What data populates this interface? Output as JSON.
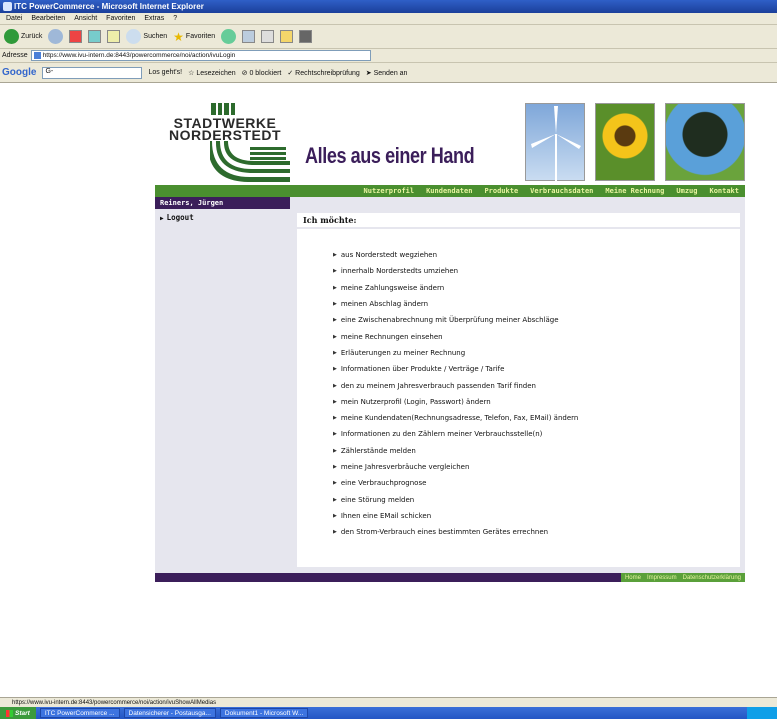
{
  "window": {
    "title": "ITC PowerCommerce - Microsoft Internet Explorer"
  },
  "menu": [
    "Datei",
    "Bearbeiten",
    "Ansicht",
    "Favoriten",
    "Extras",
    "?"
  ],
  "toolbar": {
    "back_label": "Zurück",
    "search_label": "Suchen",
    "favorites_label": "Favoriten"
  },
  "addressbar": {
    "label": "Adresse",
    "url": "https://www.ivu-intern.de:8443/powercommerce/noi/action/ivuLogin"
  },
  "googlebar": {
    "logo": "Google",
    "field": "G-",
    "go_label": "Los geht's!",
    "bookmarks_label": "Lesezeichen",
    "blocked_label": "0 blockiert",
    "spellcheck_label": "Rechtschreibprüfung",
    "send_label": "Senden an"
  },
  "page": {
    "logo_line1": "STADTWERKE",
    "logo_line2": "NORDERSTEDT",
    "slogan": "Alles aus einer Hand",
    "nav": [
      "Nutzerprofil",
      "Kundendaten",
      "Produkte",
      "Verbrauchsdaten",
      "Meine Rechnung",
      "Umzug",
      "Kontakt"
    ],
    "user_name": "Reiners, Jürgen",
    "logout_label": "Logout",
    "main_title": "Ich möchte:",
    "options": [
      "aus Norderstedt wegziehen",
      "innerhalb Norderstedts umziehen",
      "meine Zahlungsweise ändern",
      "meinen Abschlag ändern",
      "eine Zwischenabrechnung mit Überprüfung meiner Abschläge",
      "meine Rechnungen einsehen",
      "Erläuterungen zu meiner Rechnung",
      "Informationen über Produkte / Verträge / Tarife",
      "den zu meinem Jahresverbrauch passenden Tarif finden",
      "mein Nutzerprofil (Login, Passwort) ändern",
      "meine Kundendaten(Rechnungsadresse, Telefon, Fax, EMail) ändern",
      "Informationen zu den Zählern meiner Verbrauchsstelle(n)",
      "Zählerstände melden",
      "meine Jahresverbräuche vergleichen",
      "eine Verbrauchprognose",
      "eine Störung melden",
      "Ihnen eine EMail schicken",
      "den Strom-Verbrauch eines bestimmten Gerätes errechnen"
    ],
    "footer_links": [
      "Home",
      "Impressum",
      "Datenschutzerklärung"
    ]
  },
  "statusbar": {
    "url": "https://www.ivu-intern.de:8443/powercommerce/noi/action/ivuShowAllMedias"
  },
  "taskbar": {
    "start_label": "Start",
    "tasks": [
      "ITC PowerCommerce ...",
      "Datensicherer - Postausga...",
      "Dokument1 - Microsoft W..."
    ]
  },
  "colors": {
    "purple": "#3b1e5a",
    "green": "#4a8f2f",
    "sidebar_bg": "#e6e6ee"
  }
}
